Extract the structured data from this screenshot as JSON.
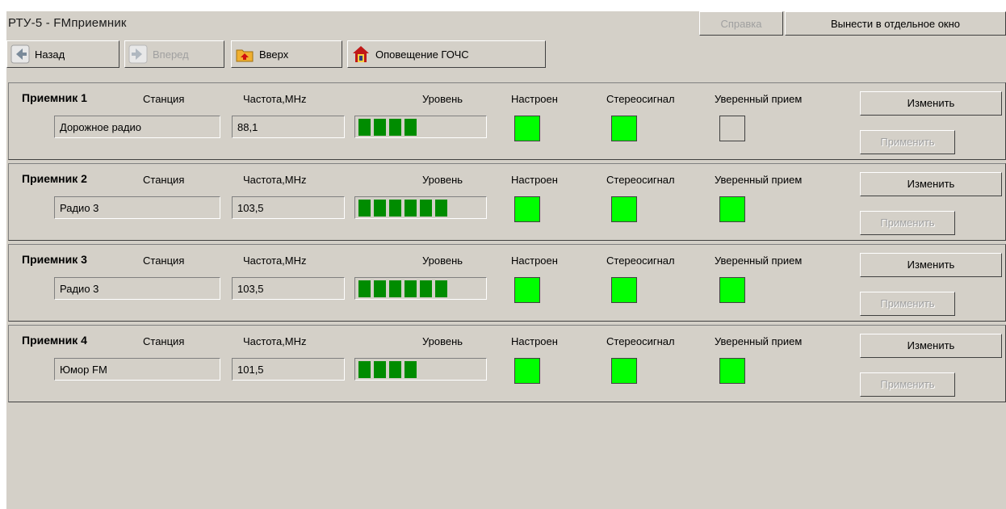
{
  "window": {
    "title": "РТУ-5 - FMприемник"
  },
  "top_buttons": {
    "help": "Справка",
    "detach": "Вынести в отдельное окно"
  },
  "nav": {
    "back": "Назад",
    "forward": "Вперед",
    "up": "Вверх",
    "alert": "Оповещение ГОЧС"
  },
  "labels": {
    "station": "Станция",
    "frequency": "Частота,MHz",
    "level": "Уровень",
    "tuned": "Настроен",
    "stereo": "Стереосигнал",
    "reliable": "Уверенный прием",
    "change": "Изменить",
    "apply": "Применить"
  },
  "receivers": [
    {
      "name": "Приемник 1",
      "station": "Дорожное радио",
      "frequency": "88,1",
      "level_segments": 4,
      "tuned": true,
      "stereo": true,
      "reliable": false
    },
    {
      "name": "Приемник 2",
      "station": "Радио 3",
      "frequency": "103,5",
      "level_segments": 6,
      "tuned": true,
      "stereo": true,
      "reliable": true
    },
    {
      "name": "Приемник 3",
      "station": "Радио 3",
      "frequency": "103,5",
      "level_segments": 6,
      "tuned": true,
      "stereo": true,
      "reliable": true
    },
    {
      "name": "Приемник 4",
      "station": "Юмор FM",
      "frequency": "101,5",
      "level_segments": 4,
      "tuned": true,
      "stereo": true,
      "reliable": true
    }
  ],
  "colors": {
    "background": "#d4d0c8",
    "indicator_on": "#00ff00",
    "level_bar": "#008c00",
    "disabled_text": "#a0a0a0"
  },
  "icons": {
    "back": "arrow-left-icon",
    "forward": "arrow-right-icon",
    "up": "folder-up-icon",
    "alert": "house-alert-icon"
  }
}
